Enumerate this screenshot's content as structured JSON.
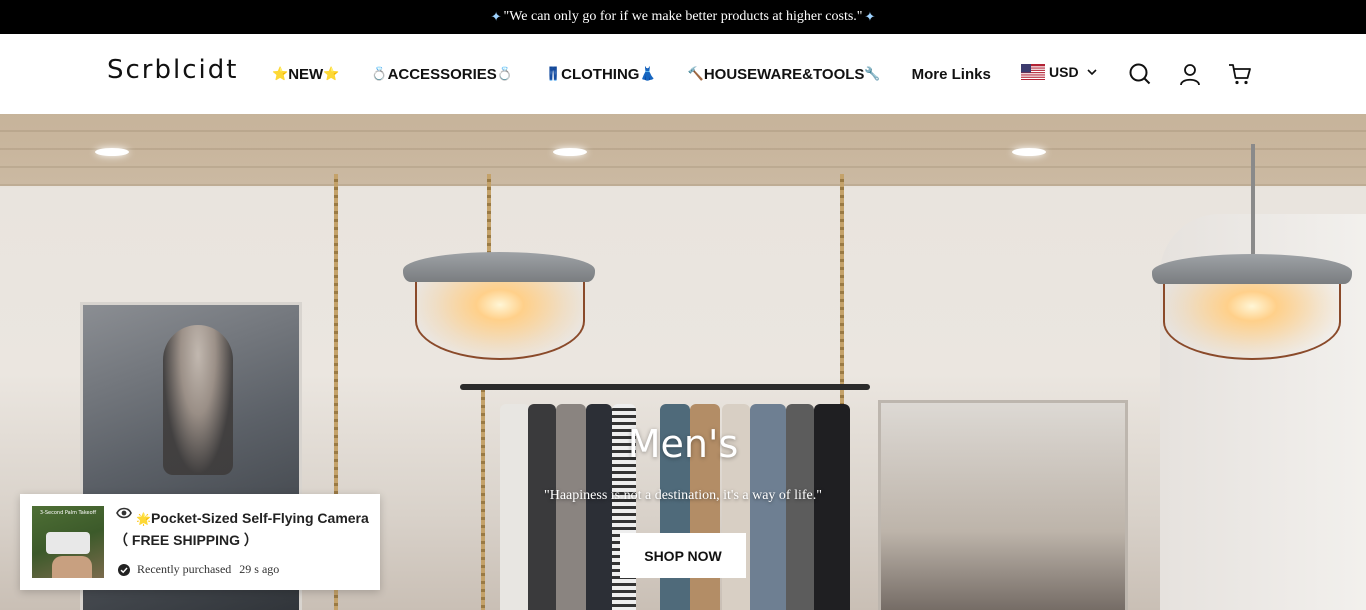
{
  "announcement": {
    "text": "\"We can only go for if we make better products at higher costs.\""
  },
  "header": {
    "logo": "Scrblcidt",
    "nav": [
      {
        "label": "NEW",
        "emoji_left": "⭐",
        "emoji_right": "⭐"
      },
      {
        "label": "ACCESSORIES",
        "emoji_left": "💍",
        "emoji_right": "💍"
      },
      {
        "label": "CLOTHING",
        "emoji_left": "👖",
        "emoji_right": "👗"
      },
      {
        "label": "HOUSEWARE&TOOLS",
        "emoji_left": "🔨",
        "emoji_right": "🔧"
      },
      {
        "label": "More Links"
      }
    ],
    "currency": "USD"
  },
  "hero": {
    "title": "Men's",
    "subtitle": "\"Haapiness is not a destination, it's a way of life.\"",
    "button_label": "SHOP NOW"
  },
  "popup": {
    "image_caption": "3-Second Palm Takeoff",
    "title_emoji": "🌟",
    "title": "Pocket-Sized Self-Flying Camera",
    "subtitle": "（ FREE SHIPPING ）",
    "purchased_label": "Recently purchased",
    "time_ago": "29 s ago"
  }
}
